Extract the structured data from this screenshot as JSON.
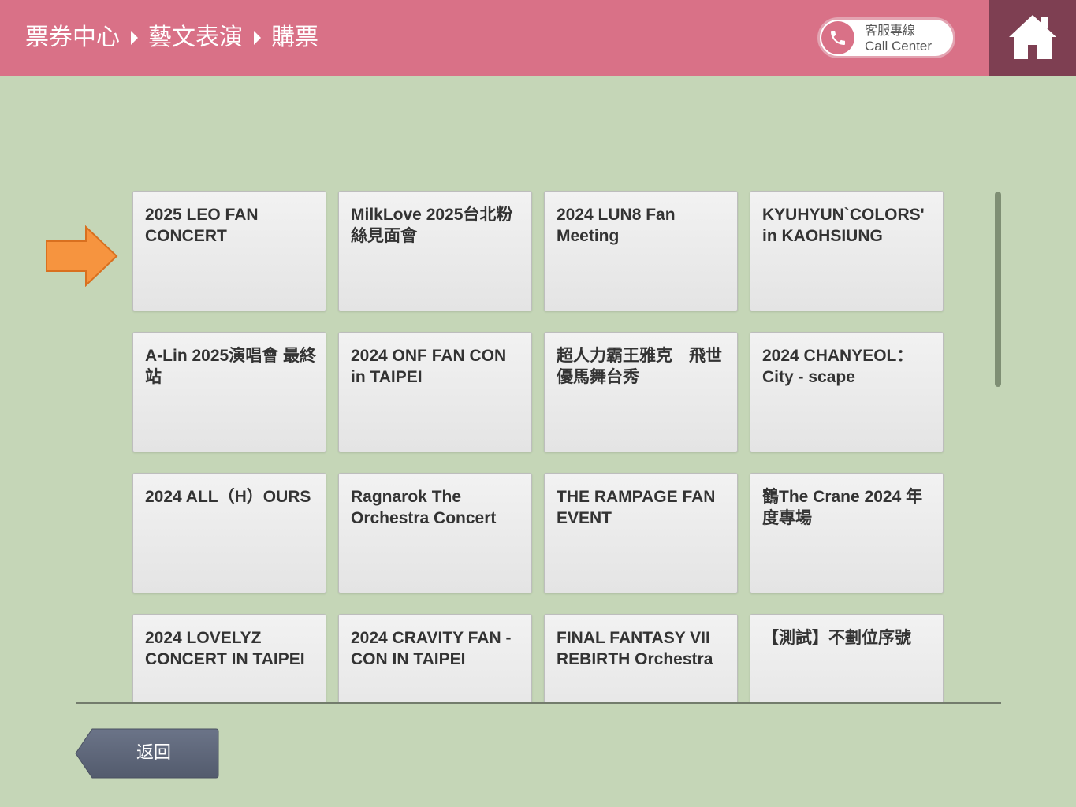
{
  "header": {
    "breadcrumb": [
      "票券中心",
      "藝文表演",
      "購票"
    ],
    "call_center": {
      "label_zh": "客服專線",
      "label_en": "Call Center",
      "icon": "phone-icon"
    },
    "home_icon": "home-icon"
  },
  "events": [
    {
      "title": "2025 LEO FAN CONCERT"
    },
    {
      "title": "MilkLove 2025台北粉絲見面會"
    },
    {
      "title": "2024 LUN8 Fan Meeting"
    },
    {
      "title": "KYUHYUN`COLORS' in KAOHSIUNG"
    },
    {
      "title": "A-Lin 2025演唱會 最終站"
    },
    {
      "title": "2024 ONF FAN CON in TAIPEI"
    },
    {
      "title": "超人力霸王雅克　飛世優馬舞台秀"
    },
    {
      "title": "2024 CHANYEOL：City - scape"
    },
    {
      "title": "2024 ALL（H）OURS"
    },
    {
      "title": "Ragnarok The Orchestra Concert"
    },
    {
      "title": "THE RAMPAGE FAN EVENT"
    },
    {
      "title": "鶴The Crane 2024 年度專場"
    },
    {
      "title": "2024 LOVELYZ CONCERT IN TAIPEI"
    },
    {
      "title": "2024 CRAVITY FAN - CON IN TAIPEI"
    },
    {
      "title": "FINAL FANTASY VII REBIRTH Orchestra"
    },
    {
      "title": "【測試】不劃位序號"
    }
  ],
  "back_button": {
    "label": "返回"
  },
  "colors": {
    "header": "#d97187",
    "home": "#7e3f52",
    "background": "#c5d6b7",
    "arrow": "#f6943f",
    "back_button": "#5d6679"
  }
}
